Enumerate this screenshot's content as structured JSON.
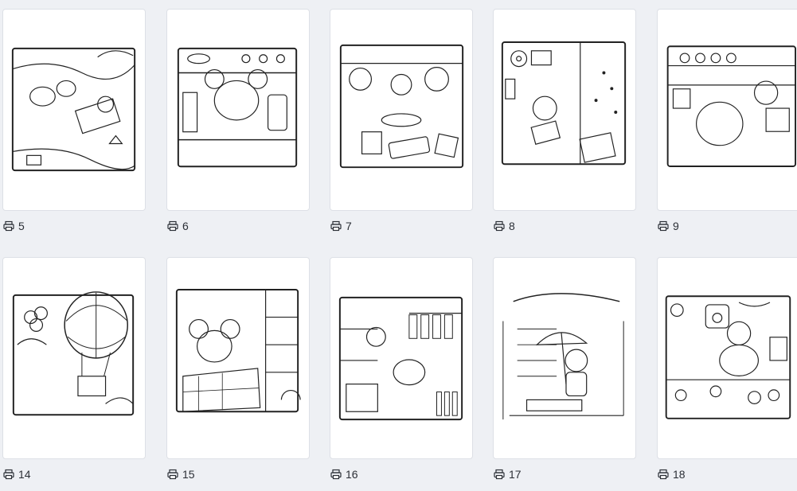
{
  "colors": {
    "background": "#eef0f4",
    "card": "#ffffff",
    "border": "#dde0e6",
    "text": "#2b2f36",
    "ink": "#222222"
  },
  "pages": [
    {
      "count": "5",
      "art": "beach-picnic-scene",
      "icon": "printer-icon"
    },
    {
      "count": "6",
      "art": "fridge-mouse-scene",
      "icon": "printer-icon"
    },
    {
      "count": "7",
      "art": "baking-bears-scene",
      "icon": "printer-icon"
    },
    {
      "count": "8",
      "art": "music-room-scene",
      "icon": "printer-icon"
    },
    {
      "count": "9",
      "art": "kitchen-shelf-scene",
      "icon": "printer-icon"
    },
    {
      "count": "14",
      "art": "hot-air-balloon-scene",
      "icon": "printer-icon"
    },
    {
      "count": "15",
      "art": "bedroom-reading-scene",
      "icon": "printer-icon"
    },
    {
      "count": "16",
      "art": "clothing-store-scene",
      "icon": "printer-icon"
    },
    {
      "count": "17",
      "art": "rainy-umbrella-scene",
      "icon": "printer-icon"
    },
    {
      "count": "18",
      "art": "cat-cafe-scene",
      "icon": "printer-icon"
    }
  ]
}
